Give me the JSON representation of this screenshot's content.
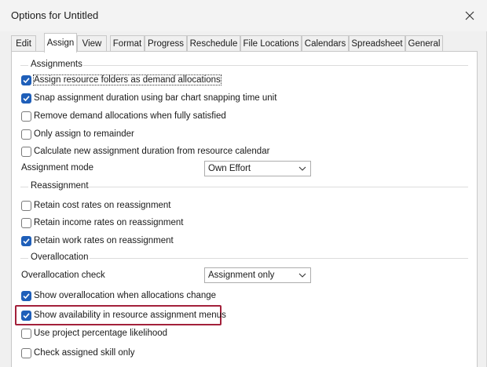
{
  "window": {
    "title": "Options for Untitled"
  },
  "tabs": [
    {
      "label": "Edit"
    },
    {
      "label": "Assign"
    },
    {
      "label": "View"
    },
    {
      "label": "Format"
    },
    {
      "label": "Progress"
    },
    {
      "label": "Reschedule"
    },
    {
      "label": "File Locations"
    },
    {
      "label": "Calendars"
    },
    {
      "label": "Spreadsheet"
    },
    {
      "label": "General"
    }
  ],
  "active_tab": "Assign",
  "assignments": {
    "group_label": "Assignments",
    "options": [
      {
        "label": "Assign resource folders as demand allocations",
        "checked": true
      },
      {
        "label": "Snap assignment duration using bar chart snapping time unit",
        "checked": true
      },
      {
        "label": "Remove demand allocations when fully satisfied",
        "checked": false
      },
      {
        "label": "Only assign to remainder",
        "checked": false
      },
      {
        "label": "Calculate new assignment duration from resource calendar",
        "checked": false
      }
    ],
    "mode_label": "Assignment mode",
    "mode_value": "Own Effort"
  },
  "reassignment": {
    "group_label": "Reassignment",
    "options": [
      {
        "label": "Retain cost rates on reassignment",
        "checked": false
      },
      {
        "label": "Retain income rates on reassignment",
        "checked": false
      },
      {
        "label": "Retain work rates on reassignment",
        "checked": true
      }
    ]
  },
  "overallocation": {
    "group_label": "Overallocation",
    "check_label": "Overallocation check",
    "check_value": "Assignment only",
    "options": [
      {
        "label": "Show overallocation when allocations change",
        "checked": true
      },
      {
        "label": "Show availability in resource assignment menus",
        "checked": true
      },
      {
        "label": "Use project percentage likelihood",
        "checked": false
      },
      {
        "label": "Check assigned skill only",
        "checked": false
      }
    ]
  },
  "icons": {
    "close": "close-icon",
    "dropdown": "chevron-down-icon",
    "check": "checkmark-icon"
  },
  "colors": {
    "accent": "#1f5fb9",
    "highlight": "#a3203a"
  }
}
